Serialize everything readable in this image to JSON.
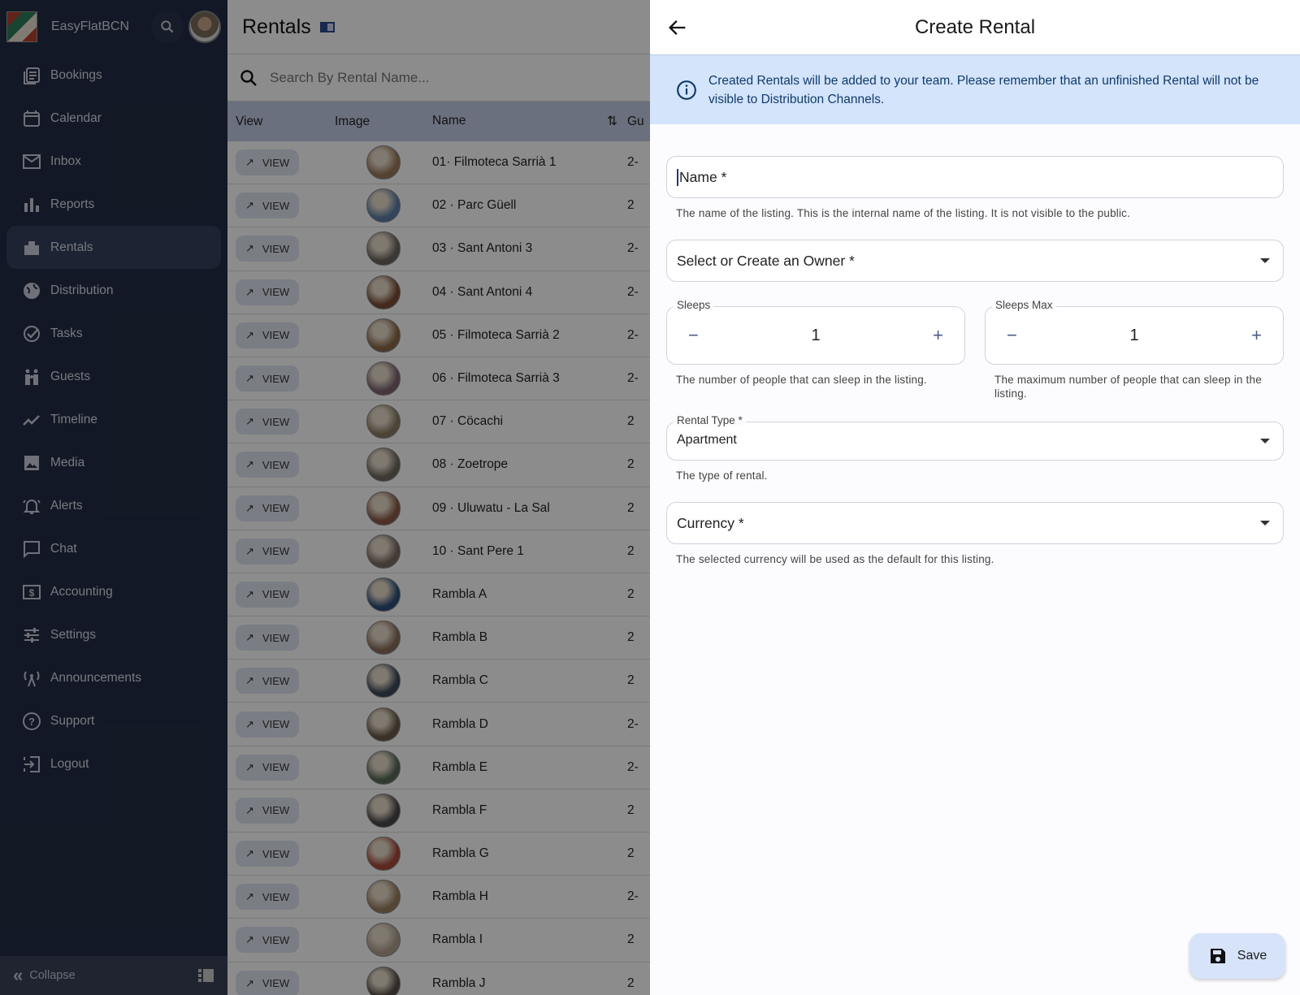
{
  "sidebar": {
    "brand": "EasyFlatBCN",
    "collapse_label": "Collapse",
    "items": [
      {
        "label": "Bookings",
        "icon": "bookings-icon"
      },
      {
        "label": "Calendar",
        "icon": "calendar-icon"
      },
      {
        "label": "Inbox",
        "icon": "mail-icon"
      },
      {
        "label": "Reports",
        "icon": "bar-chart-icon"
      },
      {
        "label": "Rentals",
        "icon": "building-icon",
        "active": true
      },
      {
        "label": "Distribution",
        "icon": "globe-icon"
      },
      {
        "label": "Tasks",
        "icon": "check-circle-icon"
      },
      {
        "label": "Guests",
        "icon": "people-icon"
      },
      {
        "label": "Timeline",
        "icon": "timeline-icon"
      },
      {
        "label": "Media",
        "icon": "image-icon"
      },
      {
        "label": "Alerts",
        "icon": "bell-icon"
      },
      {
        "label": "Chat",
        "icon": "chat-icon"
      },
      {
        "label": "Accounting",
        "icon": "dollar-icon"
      },
      {
        "label": "Settings",
        "icon": "sliders-icon"
      },
      {
        "label": "Announcements",
        "icon": "antenna-icon"
      },
      {
        "label": "Support",
        "icon": "help-icon"
      },
      {
        "label": "Logout",
        "icon": "logout-icon"
      }
    ]
  },
  "rentals": {
    "title": "Rentals",
    "search_placeholder": "Search By Rental Name...",
    "columns": [
      "View",
      "Image",
      "Name",
      "Gu"
    ],
    "view_label": "VIEW",
    "rows": [
      [
        "01· Filmoteca Sarrià 1",
        "2-"
      ],
      [
        "02 · Parc Güell",
        "2"
      ],
      [
        "03 · Sant Antoni 3",
        "2-"
      ],
      [
        "04 · Sant Antoni 4",
        "2-"
      ],
      [
        "05 · Filmoteca Sarrià 2",
        "2-"
      ],
      [
        "06 · Filmoteca Sarrià 3",
        "2-"
      ],
      [
        "07 · Cöcachi",
        "2"
      ],
      [
        "08 · Zoetrope",
        "2"
      ],
      [
        "09 · Uluwatu - La Sal",
        "2"
      ],
      [
        "10 · Sant Pere 1",
        "2"
      ],
      [
        "Rambla A",
        "2"
      ],
      [
        "Rambla B",
        "2"
      ],
      [
        "Rambla C",
        "2"
      ],
      [
        "Rambla D",
        "2-"
      ],
      [
        "Rambla E",
        "2-"
      ],
      [
        "Rambla F",
        "2"
      ],
      [
        "Rambla G",
        "2"
      ],
      [
        "Rambla H",
        "2-"
      ],
      [
        "Rambla I",
        "2"
      ],
      [
        "Rambla J",
        "2"
      ]
    ]
  },
  "drawer": {
    "title": "Create Rental",
    "info": "Created Rentals will be added to your team. Please remember that an unfinished Rental will not be visible to Distribution Channels.",
    "name_label": "Name *",
    "name_help": "The name of the listing. This is the internal name of the listing. It is not visible to the public.",
    "owner_label": "Select or Create an Owner *",
    "sleeps_label": "Sleeps",
    "sleeps_value": "1",
    "sleeps_help": "The number of people that can sleep in the listing.",
    "sleeps_max_label": "Sleeps Max",
    "sleeps_max_value": "1",
    "sleeps_max_help": "The maximum number of people that can sleep in the listing.",
    "rental_type_label": "Rental Type *",
    "rental_type_value": "Apartment",
    "rental_type_help": "The type of rental.",
    "currency_label": "Currency *",
    "currency_help": "The selected currency will be used as the default for this listing.",
    "save_label": "Save"
  },
  "colors": {
    "sidebar": "#131a28",
    "accent": "#d3e4fb",
    "info_text": "#113a6b"
  }
}
